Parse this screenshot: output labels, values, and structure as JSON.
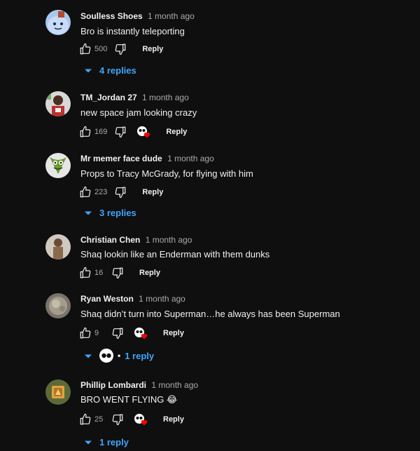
{
  "comments": [
    {
      "author": "Soulless Shoes",
      "time": "1 month ago",
      "text": "Bro is instantly teleporting",
      "likes": "500",
      "reply_label": "Reply",
      "replies_label": "4 replies"
    },
    {
      "author": "TM_Jordan 27",
      "time": "1 month ago",
      "text": "new space jam looking crazy",
      "likes": "169",
      "reply_label": "Reply"
    },
    {
      "author": "Mr memer face dude",
      "time": "1 month ago",
      "text": "Props to Tracy McGrady, for flying with him",
      "likes": "223",
      "reply_label": "Reply",
      "replies_label": "3 replies"
    },
    {
      "author": "Christian Chen",
      "time": "1 month ago",
      "text": "Shaq lookin like an Enderman with them dunks",
      "likes": "16",
      "reply_label": "Reply"
    },
    {
      "author": "Ryan Weston",
      "time": "1 month ago",
      "text": "Shaq didn’t turn into Superman…he always has been Superman",
      "likes": "9",
      "reply_label": "Reply",
      "replies_label": "1 reply"
    },
    {
      "author": "Phillip Lombardi",
      "time": "1 month ago",
      "text": "BRO WENT FLYING 😂",
      "likes": "25",
      "reply_label": "Reply",
      "replies_label": "1 reply"
    }
  ],
  "colors": {
    "background": "#0f0f0f",
    "link": "#3ea6ff",
    "muted": "#aaaaaa",
    "heart": "#ff0000"
  },
  "icons": {
    "like": "thumbs-up-icon",
    "dislike": "thumbs-down-icon",
    "creator_heart": "creator-heart-icon",
    "expand": "chevron-down-icon"
  }
}
